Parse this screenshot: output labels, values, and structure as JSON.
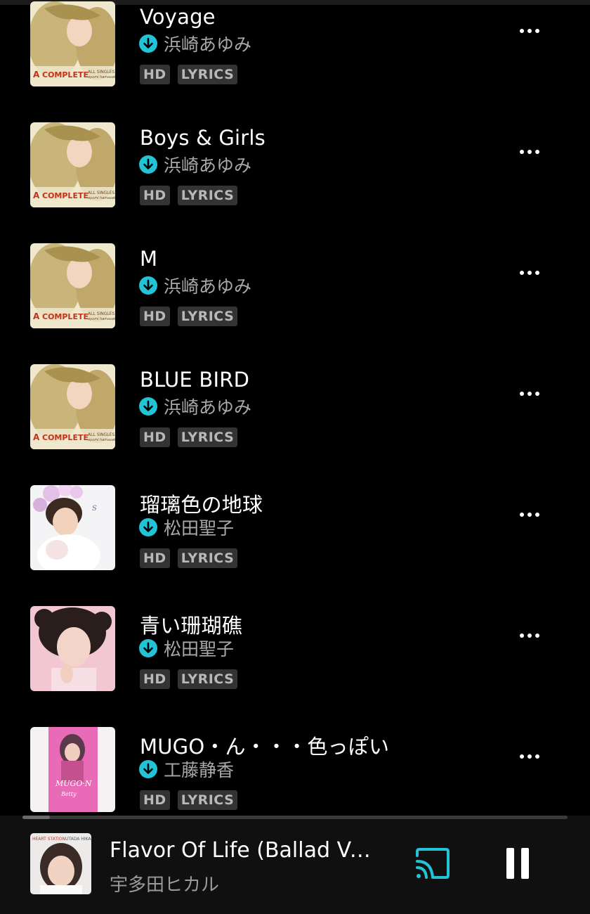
{
  "tracks": [
    {
      "title": "Voyage",
      "artist": "浜崎あゆみ",
      "badges": [
        "HD",
        "LYRICS"
      ],
      "art": "ayu"
    },
    {
      "title": "Boys & Girls",
      "artist": "浜崎あゆみ",
      "badges": [
        "HD",
        "LYRICS"
      ],
      "art": "ayu"
    },
    {
      "title": "M",
      "artist": "浜崎あゆみ",
      "badges": [
        "HD",
        "LYRICS"
      ],
      "art": "ayu"
    },
    {
      "title": "BLUE BIRD",
      "artist": "浜崎あゆみ",
      "badges": [
        "HD",
        "LYRICS"
      ],
      "art": "ayu"
    },
    {
      "title": "瑠璃色の地球",
      "artist": "松田聖子",
      "badges": [
        "HD",
        "LYRICS"
      ],
      "art": "seiko1"
    },
    {
      "title": "青い珊瑚礁",
      "artist": "松田聖子",
      "badges": [
        "HD",
        "LYRICS"
      ],
      "art": "seiko2"
    },
    {
      "title": "MUGO・ん・・・色っぽい",
      "artist": "工藤静香",
      "badges": [
        "HD",
        "LYRICS"
      ],
      "art": "kudo"
    }
  ],
  "album_art": {
    "ayu": {
      "logo": "A",
      "text": "COMPLETE",
      "subtext": "ALL SINGLES",
      "signature": "ayumi hamasaki"
    },
    "kudo": {
      "text": "MUGO·N",
      "subtext": "Betty"
    }
  },
  "mini_player": {
    "title": "Flavor Of Life (Ballad Version)",
    "artist": "宇多田ヒカル",
    "progress": 0.05,
    "art": {
      "text": "HEART STATION",
      "subtext": "UTADA HIKARU"
    }
  },
  "colors": {
    "accent": "#22c3d6",
    "background": "#000000",
    "secondary_text": "#a9a9a9",
    "badge_bg": "#333333"
  },
  "icons": {
    "download": "download-arrow-icon",
    "more": "more-dots-icon",
    "cast": "cast-icon",
    "pause": "pause-icon"
  }
}
